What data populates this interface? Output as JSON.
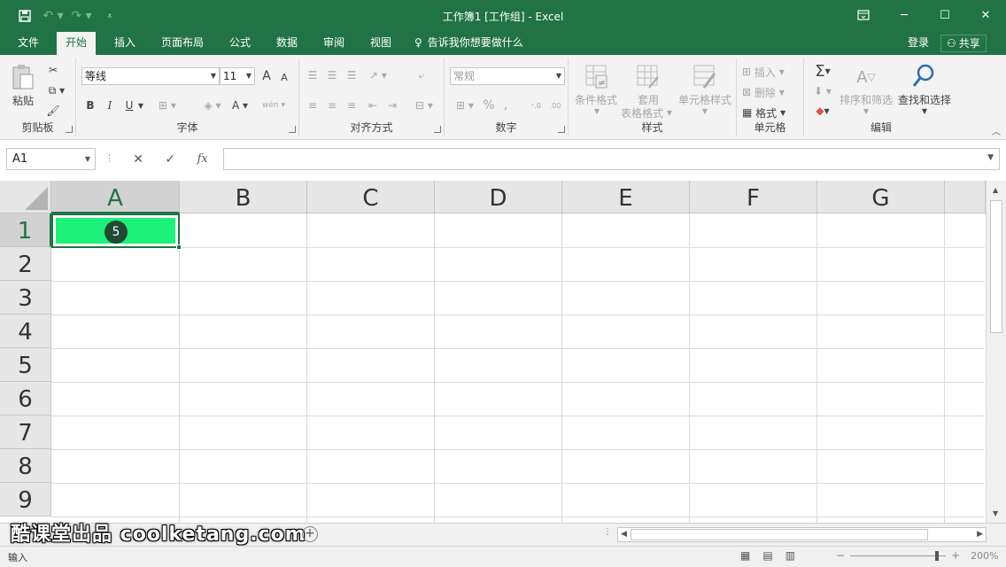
{
  "window": {
    "title": "工作簿1  [工作组] - Excel"
  },
  "qat": {
    "save_icon": "save-icon",
    "undo_icon": "undo-icon",
    "redo_icon": "redo-icon",
    "customize_icon": "customize-icon"
  },
  "tabs": [
    {
      "label": "文件"
    },
    {
      "label": "开始"
    },
    {
      "label": "插入"
    },
    {
      "label": "页面布局"
    },
    {
      "label": "公式"
    },
    {
      "label": "数据"
    },
    {
      "label": "审阅"
    },
    {
      "label": "视图"
    }
  ],
  "tell_me": "告诉我你想要做什么",
  "login": "登录",
  "share": "共享",
  "ribbon": {
    "clipboard": {
      "paste": "粘贴",
      "label": "剪贴板"
    },
    "font": {
      "name": "等线",
      "size": "11",
      "bold": "B",
      "italic": "I",
      "underline": "U",
      "grow": "A",
      "shrink": "A",
      "color": "A",
      "wen": "wén",
      "label": "字体"
    },
    "alignment": {
      "label": "对齐方式"
    },
    "number": {
      "format": "常规",
      "percent": "%",
      "comma": ",",
      "label": "数字"
    },
    "styles": {
      "conditional": "条件格式",
      "table_line1": "套用",
      "table_line2": "表格格式",
      "cell_styles": "单元格样式",
      "label": "样式"
    },
    "cells": {
      "insert": "插入",
      "delete": "删除",
      "format": "格式",
      "label": "单元格"
    },
    "editing": {
      "sort": "排序和筛选",
      "find": "查找和选择",
      "label": "编辑"
    }
  },
  "formula_bar": {
    "name_box": "A1",
    "fx": "fx",
    "value": ""
  },
  "grid": {
    "columns": [
      "A",
      "B",
      "C",
      "D",
      "E",
      "F",
      "G"
    ],
    "rows": [
      "1",
      "2",
      "3",
      "4",
      "5",
      "6",
      "7",
      "8",
      "9"
    ],
    "selected_cell": "A1",
    "selected_fill": "#1ef17a",
    "step_badge": "5"
  },
  "sheetbar": {
    "watermark": "酷课堂出品 coolketang.com"
  },
  "status": {
    "mode": "输入",
    "zoom": "200%"
  },
  "colors": {
    "brand": "#217346"
  }
}
